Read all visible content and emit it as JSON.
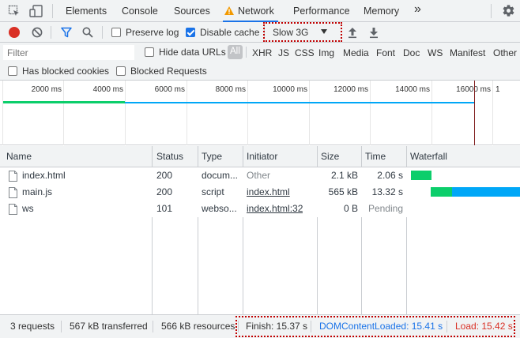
{
  "tabs": {
    "elements": "Elements",
    "console": "Console",
    "sources": "Sources",
    "network": "Network",
    "performance": "Performance",
    "memory": "Memory",
    "more": "»"
  },
  "toolbar": {
    "preserve_log": "Preserve log",
    "preserve_log_checked": false,
    "disable_cache": "Disable cache",
    "disable_cache_checked": true,
    "throttle": "Slow 3G"
  },
  "filter": {
    "placeholder": "Filter",
    "hide_data_urls": "Hide data URLs",
    "types": [
      "All",
      "XHR",
      "JS",
      "CSS",
      "Img",
      "Media",
      "Font",
      "Doc",
      "WS",
      "Manifest",
      "Other"
    ],
    "has_blocked_cookies": "Has blocked cookies",
    "blocked_requests": "Blocked Requests"
  },
  "overview": {
    "ticks": [
      "2000 ms",
      "4000 ms",
      "6000 ms",
      "8000 ms",
      "10000 ms",
      "12000 ms",
      "14000 ms",
      "16000 ms"
    ],
    "last_tick_partial": "1"
  },
  "table": {
    "headers": [
      "Name",
      "Status",
      "Type",
      "Initiator",
      "Size",
      "Time",
      "Waterfall"
    ],
    "rows": [
      {
        "name": "index.html",
        "status": "200",
        "type": "docum...",
        "initiator": "Other",
        "size": "2.1 kB",
        "time": "2.06 s"
      },
      {
        "name": "main.js",
        "status": "200",
        "type": "script",
        "initiator": "index.html",
        "size": "565 kB",
        "time": "13.32 s"
      },
      {
        "name": "ws",
        "status": "101",
        "type": "webso...",
        "initiator": "index.html:32",
        "size": "0 B",
        "time": "Pending"
      }
    ]
  },
  "status": {
    "requests": "3 requests",
    "transferred": "567 kB transferred",
    "resources": "566 kB resources",
    "finish": "Finish: 15.37 s",
    "dcl": "DOMContentLoaded: 15.41 s",
    "load": "Load: 15.42 s"
  },
  "colors": {
    "accent": "#1a73e8",
    "record": "#d93025",
    "warning": "#f29900",
    "dcl_blue": "#1a73e8",
    "load_red": "#d93025",
    "waterfall_green": "#0cce6b",
    "waterfall_blue": "#00a7f7",
    "highlight_border": "#c00000"
  }
}
